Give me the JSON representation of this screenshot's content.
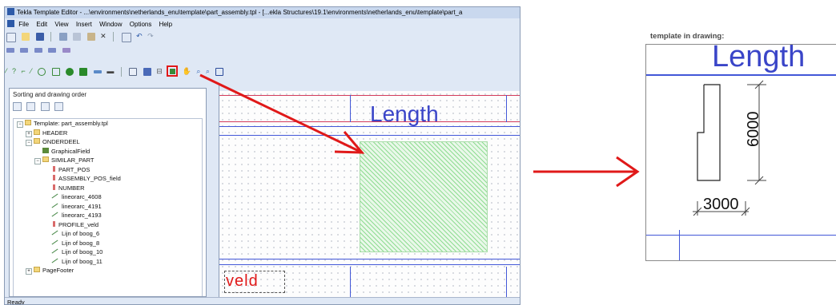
{
  "window": {
    "title": "Tekla Template Editor - ...\\environments\\netherlands_enu\\template\\part_assembly.tpl  - [...ekla Structures\\19.1\\environments\\netherlands_enu\\template\\part_a",
    "menu": [
      "File",
      "Edit",
      "View",
      "Insert",
      "Window",
      "Options",
      "Help"
    ]
  },
  "sidebar": {
    "title": "Sorting and drawing order",
    "tree": [
      {
        "label": "Template: part_assembly.tpl",
        "icon": "folder-icon",
        "depth": 0
      },
      {
        "label": "HEADER",
        "icon": "folder-icon",
        "depth": 1
      },
      {
        "label": "ONDERDEEL",
        "icon": "folder-icon",
        "depth": 1
      },
      {
        "label": "GraphicalField",
        "icon": "graphical-field-icon",
        "depth": 2
      },
      {
        "label": "SIMILAR_PART",
        "icon": "folder-icon",
        "depth": 2
      },
      {
        "label": "PART_POS",
        "icon": "value-field-icon",
        "depth": 3
      },
      {
        "label": "ASSEMBLY_POS_field",
        "icon": "value-field-icon",
        "depth": 3
      },
      {
        "label": "NUMBER",
        "icon": "value-field-icon",
        "depth": 3
      },
      {
        "label": "lineorarc_4608",
        "icon": "line-icon",
        "depth": 3
      },
      {
        "label": "lineorarc_4191",
        "icon": "line-icon",
        "depth": 3
      },
      {
        "label": "lineorarc_4193",
        "icon": "line-icon",
        "depth": 3
      },
      {
        "label": "PROFILE_veld",
        "icon": "value-field-icon",
        "depth": 3
      },
      {
        "label": "Lijn of boog_6",
        "icon": "line-icon",
        "depth": 3
      },
      {
        "label": "Lijn of boog_8",
        "icon": "line-icon",
        "depth": 3
      },
      {
        "label": "Lijn of boog_10",
        "icon": "line-icon",
        "depth": 3
      },
      {
        "label": "Lijn of boog_11",
        "icon": "line-icon",
        "depth": 3
      },
      {
        "label": "PageFooter",
        "icon": "folder-icon",
        "depth": 1
      }
    ]
  },
  "canvas": {
    "length_label": "Length",
    "veld_label": "veld"
  },
  "status": "Ready",
  "drawing": {
    "caption": "template in drawing:",
    "length_label": "Length",
    "height_dim": "6000",
    "width_dim": "3000"
  },
  "colors": {
    "highlight": "#e01919",
    "arrow": "#e01919",
    "template_blue": "#3a45c8",
    "graphical_field_fill": "#8fdc92"
  }
}
